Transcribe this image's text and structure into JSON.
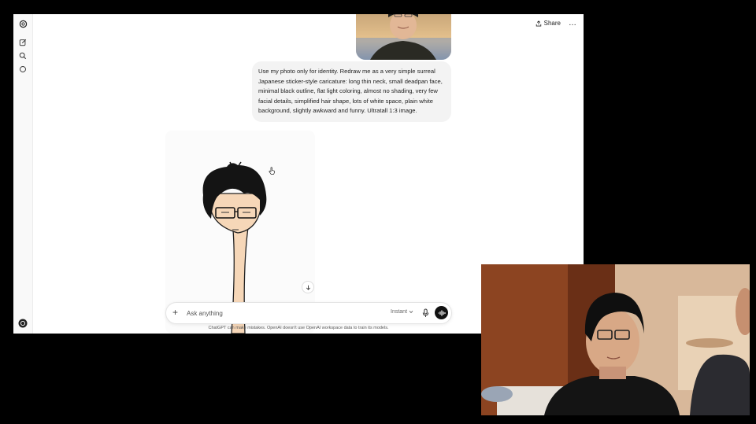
{
  "header": {
    "share_label": "Share",
    "more_label": "…"
  },
  "sidebar": {
    "icons": [
      "openai-logo-icon",
      "new-chat-icon",
      "search-icon",
      "library-icon",
      "profile-icon"
    ]
  },
  "conversation": {
    "user_message": "Use my photo only for identity. Redraw me as a very simple surreal Japanese sticker-style caricature: long thin neck, small deadpan face, minimal black outline, flat light coloring, almost no shading, very few facial details, simplified hair shape, lots of white space, plain white background, slightly awkward and funny. Ultratall 1:3 image."
  },
  "composer": {
    "placeholder": "Ask anything",
    "mode_label": "Instant"
  },
  "footer": {
    "note": "ChatGPT can make mistakes. OpenAI doesn't use OpenAI workspace data to train its models."
  },
  "colors": {
    "background": "#000000",
    "screen": "#ffffff",
    "bubble": "#f3f3f3",
    "skin": "#f6d7b8",
    "pip_wall": "#7a3a1d"
  }
}
